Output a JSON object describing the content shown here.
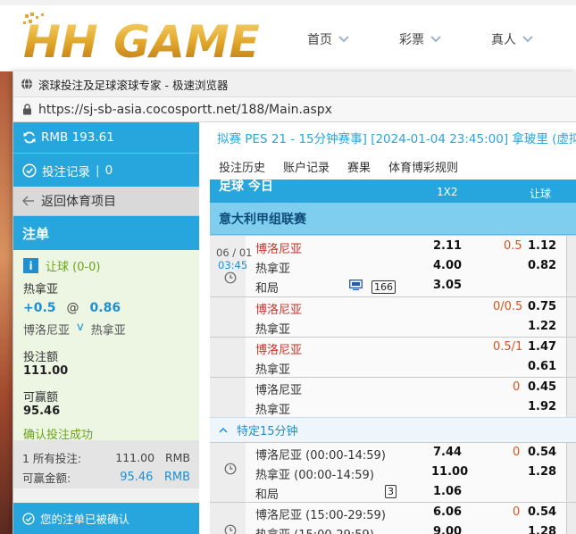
{
  "site": {
    "logo_text": "HH GAME",
    "nav": [
      {
        "label": "首页"
      },
      {
        "label": "彩票"
      },
      {
        "label": "真人"
      }
    ]
  },
  "window": {
    "title": "滚球投注及足球滚球专家 - 极速浏览器",
    "url": "https://sj-sb-asia.cocosportt.net/188/Main.aspx"
  },
  "betslip": {
    "balance": "RMB 193.61",
    "bet_records_label": "投注记录",
    "bet_records_count": "0",
    "back_label": "返回体育项目",
    "header": "注单",
    "market": "让球 (0-0)",
    "selection": "热拿亚",
    "handicap": "+0.5",
    "at": "@",
    "odds": "0.86",
    "home": "博洛尼亚",
    "vs": "v",
    "away": "热拿亚",
    "stake_label": "投注额",
    "stake": "111.00",
    "win_label": "可赢额",
    "win": "95.46",
    "success": "确认投注成功",
    "total_label": "1 所有投注:",
    "total_amount": "111.00",
    "total_currency": "RMB",
    "potential_label": "可赢金额:",
    "potential_amount": "95.46",
    "potential_currency": "RMB",
    "confirmed": "您的注单已被确认"
  },
  "main": {
    "marquee": "拟赛 PES 21 - 15分钟赛事] [2024-01-04 23:45:00] 拿玻里 (虚拟",
    "tabs": [
      {
        "label": "投注历史"
      },
      {
        "label": "账户记录"
      },
      {
        "label": "赛果"
      },
      {
        "label": "体育博彩规则"
      }
    ],
    "sport": "足球 今日",
    "col_1x2": "1X2",
    "col_hdp": "让球",
    "league": "意大利甲组联赛",
    "match1": {
      "date": "06 / 01",
      "time": "03:45",
      "count": "166",
      "rows": [
        {
          "team": "博洛尼亚",
          "x12": "2.11",
          "hdp": "0.5",
          "odds": "1.12"
        },
        {
          "team": "热拿亚",
          "x12": "4.00",
          "hdp": "",
          "odds": "0.82"
        },
        {
          "team": "和局",
          "x12": "3.05",
          "hdp": "",
          "odds": ""
        }
      ],
      "alt": [
        {
          "home": "博洛尼亚",
          "away": "热拿亚",
          "hdp": "0/0.5",
          "home_odds": "0.75",
          "away_odds": "1.22"
        },
        {
          "home": "博洛尼亚",
          "away": "热拿亚",
          "hdp": "0.5/1",
          "home_odds": "1.47",
          "away_odds": "0.61"
        },
        {
          "home": "博洛尼亚",
          "away": "热拿亚",
          "hdp": "0",
          "home_odds": "0.45",
          "away_odds": "1.92"
        }
      ]
    },
    "section": "特定15分钟",
    "match2": {
      "count": "3",
      "rows": [
        {
          "team": "博洛尼亚 (00:00-14:59)",
          "x12": "7.44",
          "hdp": "0",
          "odds": "0.54"
        },
        {
          "team": "热拿亚 (00:00-14:59)",
          "x12": "11.00",
          "hdp": "",
          "odds": "1.28"
        },
        {
          "team": "和局",
          "x12": "1.06",
          "hdp": "",
          "odds": ""
        }
      ]
    },
    "match3": {
      "rows": [
        {
          "team": "博洛尼亚 (15:00-29:59)",
          "x12": "6.06",
          "hdp": "0",
          "odds": "0.54"
        },
        {
          "team": "热拿亚 (15:00-29:59)",
          "x12": "9.00",
          "hdp": "",
          "odds": "1.28"
        }
      ]
    }
  },
  "colors": {
    "accent": "#26a6dc",
    "league_bg": "#7fcef0",
    "success_green": "#6ca41c",
    "home_red": "#c9312b",
    "handicap_orange": "#d9531e"
  },
  "icons": [
    "refresh-icon",
    "check-circle-icon",
    "arrow-left-icon",
    "info-icon",
    "speaker-icon",
    "clock-icon",
    "tv-icon",
    "chevron-up-icon",
    "chevron-down-icon",
    "lock-icon",
    "globe-icon"
  ]
}
